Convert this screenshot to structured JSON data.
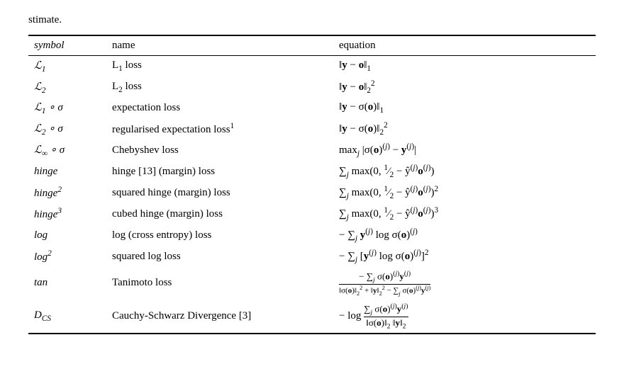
{
  "intro": "stimate.",
  "table": {
    "headers": {
      "symbol": "symbol",
      "name": "name",
      "equation": "equation"
    },
    "rows": [
      {
        "symbol_html": "&#x2112;<sub>1</sub>",
        "name_html": "L<sub>1</sub> loss",
        "equation_html": "&#x2016;<b>y</b> &minus; <b>o</b>&#x2016;<sub>1</sub>"
      },
      {
        "symbol_html": "&#x2112;<sub>2</sub>",
        "name_html": "L<sub>2</sub> loss",
        "equation_html": "&#x2016;<b>y</b> &minus; <b>o</b>&#x2016;<sub>2</sub><sup>2</sup>"
      },
      {
        "symbol_html": "&#x2112;<sub>1</sub> &#x2218; &#x03C3;",
        "name_html": "expectation loss",
        "equation_html": "&#x2016;<b>y</b> &minus; &#x03C3;(<b>o</b>)&#x2016;<sub>1</sub>"
      },
      {
        "symbol_html": "&#x2112;<sub>2</sub> &#x2218; &#x03C3;",
        "name_html": "regularised expectation loss<sup>1</sup>",
        "equation_html": "&#x2016;<b>y</b> &minus; &#x03C3;(<b>o</b>)&#x2016;<sub>2</sub><sup>2</sup>"
      },
      {
        "symbol_html": "&#x2112;<sub>&#x221E;</sub> &#x2218; &#x03C3;",
        "name_html": "Chebyshev loss",
        "equation_html": "max<sub><i>j</i></sub> |&#x03C3;(<b>o</b>)<sup>(<i>j</i>)</sup> &minus; <b>y</b><sup>(<i>j</i>)</sup>|"
      },
      {
        "symbol_html": "hinge",
        "name_html": "hinge [13] (margin) loss",
        "equation_html": "&sum;<sub><i>j</i></sub> max(0, <span style='white-space:nowrap'><sup>1</sup>&frasl;<sub>2</sub></span> &minus; &#x177;<sup>(<i>j</i>)</sup><b>o</b><sup>(<i>j</i>)</sup>)"
      },
      {
        "symbol_html": "hinge<sup>2</sup>",
        "name_html": "squared hinge (margin) loss",
        "equation_html": "&sum;<sub><i>j</i></sub> max(0, <span style='white-space:nowrap'><sup>1</sup>&frasl;<sub>2</sub></span> &minus; &#x177;<sup>(<i>j</i>)</sup><b>o</b><sup>(<i>j</i>)</sup>)<sup>2</sup>"
      },
      {
        "symbol_html": "hinge<sup>3</sup>",
        "name_html": "cubed hinge (margin) loss",
        "equation_html": "&sum;<sub><i>j</i></sub> max(0, <span style='white-space:nowrap'><sup>1</sup>&frasl;<sub>2</sub></span> &minus; &#x177;<sup>(<i>j</i>)</sup><b>o</b><sup>(<i>j</i>)</sup>)<sup>3</sup>"
      },
      {
        "symbol_html": "log",
        "name_html": "log (cross entropy) loss",
        "equation_html": "&minus; &sum;<sub><i>j</i></sub> <b>y</b><sup>(<i>j</i>)</sup> log &#x03C3;(<b>o</b>)<sup>(<i>j</i>)</sup>"
      },
      {
        "symbol_html": "log<sup>2</sup>",
        "name_html": "squared log loss",
        "equation_html": "&minus; &sum;<sub><i>j</i></sub> [<b>y</b><sup>(<i>j</i>)</sup> log &#x03C3;(<b>o</b>)<sup>(<i>j</i>)</sup>]<sup>2</sup>"
      },
      {
        "symbol_html": "tan",
        "name_html": "Tanimoto loss",
        "equation_html": "tanimoto"
      },
      {
        "symbol_html": "D<sub>CS</sub>",
        "name_html": "Cauchy-Schwarz Divergence [3]",
        "equation_html": "dcs"
      }
    ]
  }
}
